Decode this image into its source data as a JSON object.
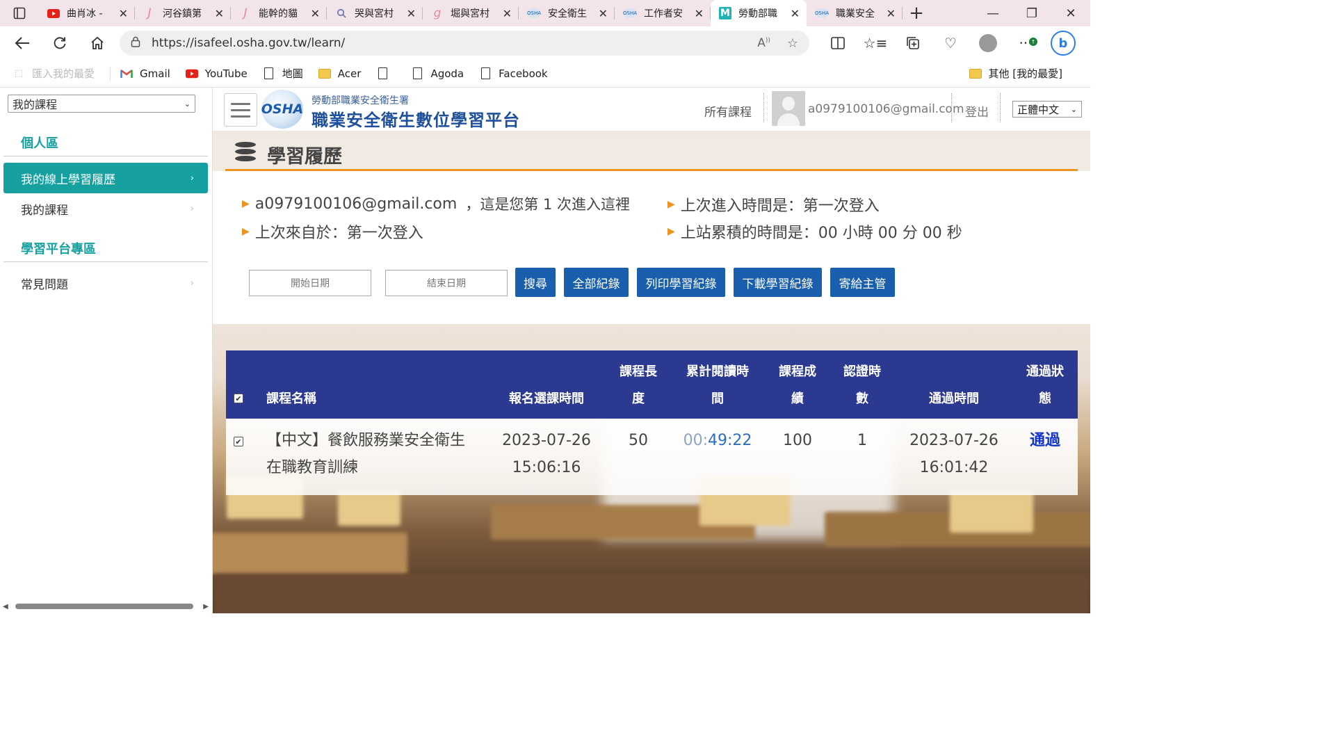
{
  "browser": {
    "tabs": [
      {
        "label": "曲肖冰 -",
        "icon": "youtube-icon",
        "active": false
      },
      {
        "label": "河谷鎮第",
        "icon": "j-icon",
        "active": false
      },
      {
        "label": "能幹的貓",
        "icon": "j-icon",
        "active": false
      },
      {
        "label": "哭與宮村",
        "icon": "search-icon",
        "active": false
      },
      {
        "label": "堀與宮村",
        "icon": "g-icon",
        "active": false
      },
      {
        "label": "安全衛生",
        "icon": "osha-icon",
        "active": false
      },
      {
        "label": "工作者安",
        "icon": "osha-icon",
        "active": false
      },
      {
        "label": "勞動部職",
        "icon": "m-icon",
        "active": true
      },
      {
        "label": "職業安全",
        "icon": "osha-icon",
        "active": false
      }
    ],
    "url": "https://isafeel.osha.gov.tw/learn/",
    "favorites": [
      {
        "label": "匯入我的最愛",
        "icon": "import-icon",
        "muted": true
      },
      {
        "label": "Gmail",
        "icon": "gmail-icon"
      },
      {
        "label": "YouTube",
        "icon": "youtube-icon"
      },
      {
        "label": "地圖",
        "icon": "doc-icon"
      },
      {
        "label": "Acer",
        "icon": "folder-icon"
      },
      {
        "label": "",
        "icon": "doc-icon"
      },
      {
        "label": "Agoda",
        "icon": "doc-icon"
      },
      {
        "label": "Facebook",
        "icon": "doc-icon"
      }
    ],
    "other_favorites": "其他 [我的最愛]"
  },
  "sidebar": {
    "course_select": "我的課程",
    "section_personal": "個人區",
    "items": [
      {
        "label": "我的線上學習履歷",
        "active": true
      },
      {
        "label": "我的課程",
        "active": false
      }
    ],
    "section_platform": "學習平台專區",
    "faq": "常見問題"
  },
  "header": {
    "logo_text": "OSHA",
    "agency": "勞動部職業安全衛生署",
    "site_title": "職業安全衛生數位學習平台",
    "all_courses": "所有課程",
    "email": "a0979100106@gmail.com",
    "logout": "登出",
    "language": "正體中文"
  },
  "main": {
    "page_title": "學習履歷",
    "info": {
      "email": "a0979100106@gmail.com",
      "visit_note": "，這是您第 1 次進入這裡",
      "last_entry": "上次進入時間是：第一次登入",
      "last_from": "上次來自於：第一次登入",
      "total_time": "上站累積的時間是：00 小時 00 分 00 秒"
    },
    "filters": {
      "start_date": "開始日期",
      "end_date": "結束日期"
    },
    "buttons": {
      "search": "搜尋",
      "all_records": "全部紀錄",
      "print": "列印學習紀錄",
      "download": "下載學習紀錄",
      "send": "寄給主管"
    },
    "table": {
      "headers": {
        "name": "課程名稱",
        "enroll": "報名選課時間",
        "length_1": "課程長",
        "length_2": "度",
        "read_1": "累計閱讀時",
        "read_2": "間",
        "score_1": "課程成",
        "score_2": "績",
        "hours_1": "認證時",
        "hours_2": "數",
        "pass_time": "通過時間",
        "status_1": "通過狀",
        "status_2": "態"
      },
      "rows": [
        {
          "name_1": "【中文】餐飲服務業安全衛生",
          "name_2": "在職教育訓練",
          "enroll_date": "2023-07-26",
          "enroll_time": "15:06:16",
          "length": "50",
          "read_prefix": "00:",
          "read_value": "49:22",
          "score": "100",
          "hours": "1",
          "pass_date": "2023-07-26",
          "pass_time": "16:01:42",
          "status": "通過"
        }
      ]
    }
  },
  "colors": {
    "teal": "#16a0a0",
    "navy_header": "#2b3990",
    "button_blue": "#1a5fae",
    "orange_accent": "#f0921e"
  }
}
